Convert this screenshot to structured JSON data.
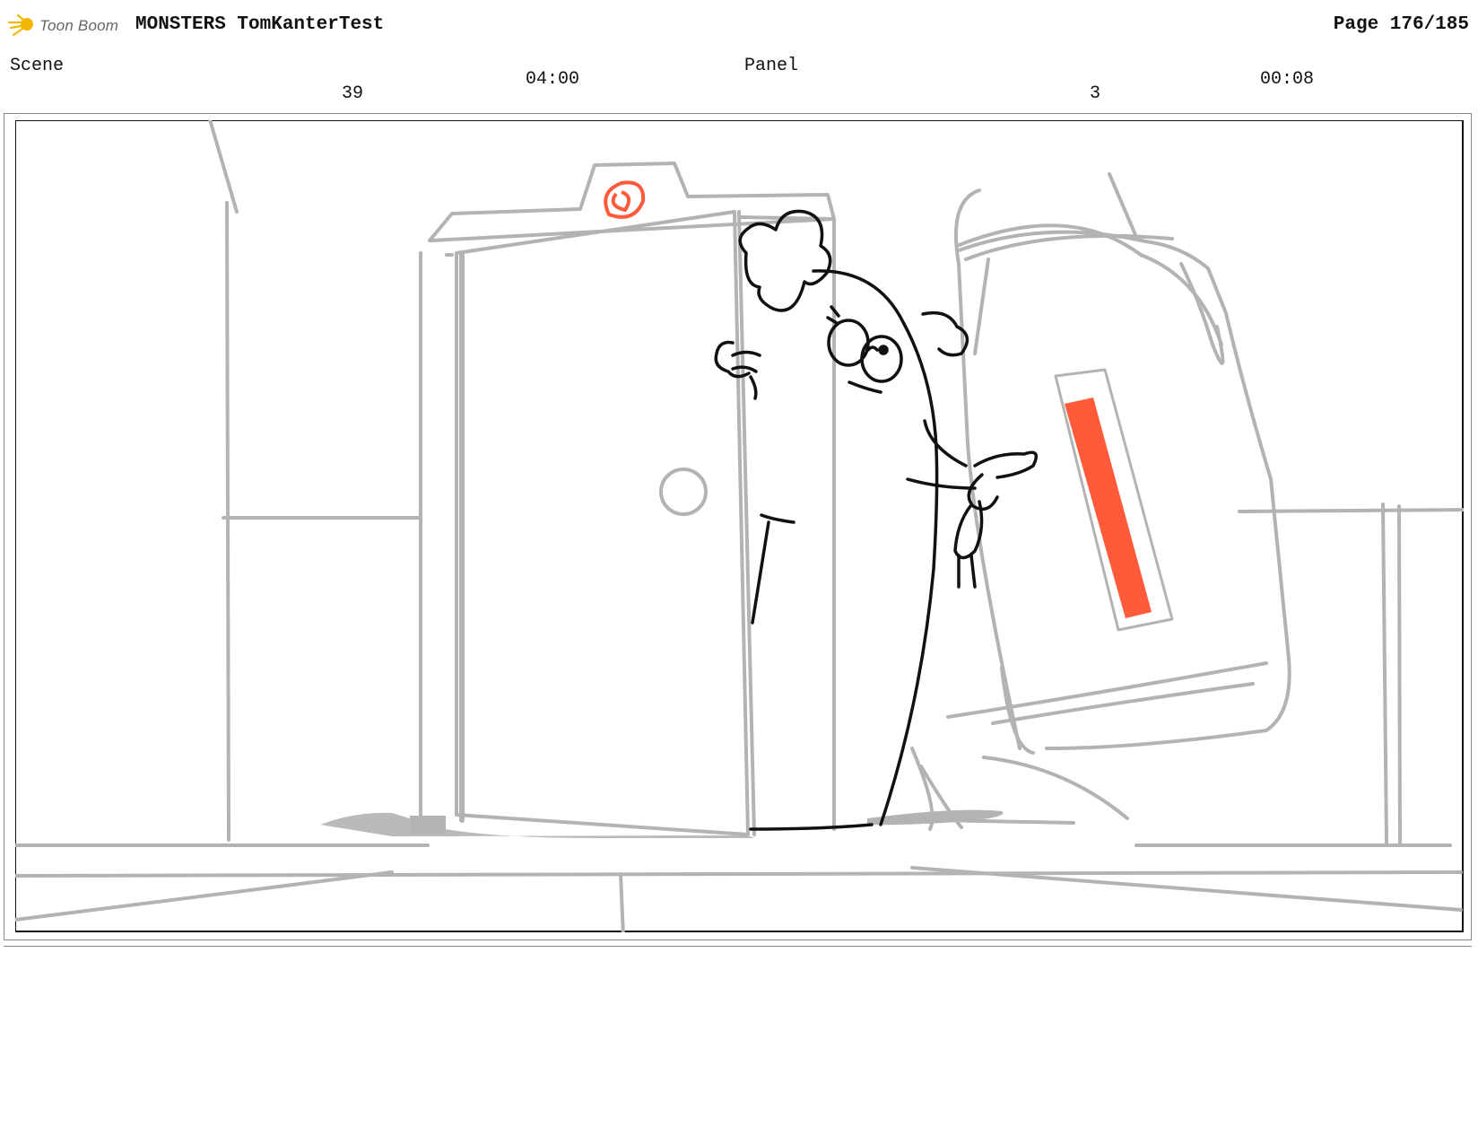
{
  "header": {
    "logo_text": "Toon Boom",
    "project_title": "MONSTERS TomKanterTest",
    "page_indicator": "Page 176/185"
  },
  "scene": {
    "label": "Scene",
    "number": "39",
    "duration": "04:00"
  },
  "panel": {
    "label": "Panel",
    "number": "3",
    "duration": "00:08"
  },
  "colors": {
    "sketch_gray": "#b3b3b3",
    "ink": "#111111",
    "accent_red": "#ff5a3a"
  },
  "icons": {
    "logo": "toon-boom-logo-icon"
  }
}
